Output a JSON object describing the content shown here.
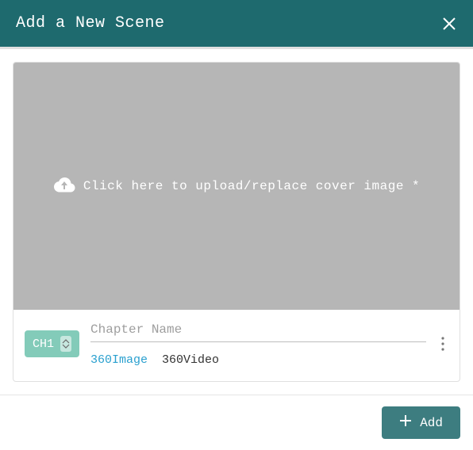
{
  "header": {
    "title": "Add a New Scene"
  },
  "upload": {
    "text": "Click here to upload/replace cover image *"
  },
  "chapter_select": {
    "value": "CH1"
  },
  "chapter_input": {
    "placeholder": "Chapter Name",
    "value": ""
  },
  "type_options": {
    "image": "360Image",
    "video": "360Video"
  },
  "footer": {
    "add_label": "Add"
  }
}
